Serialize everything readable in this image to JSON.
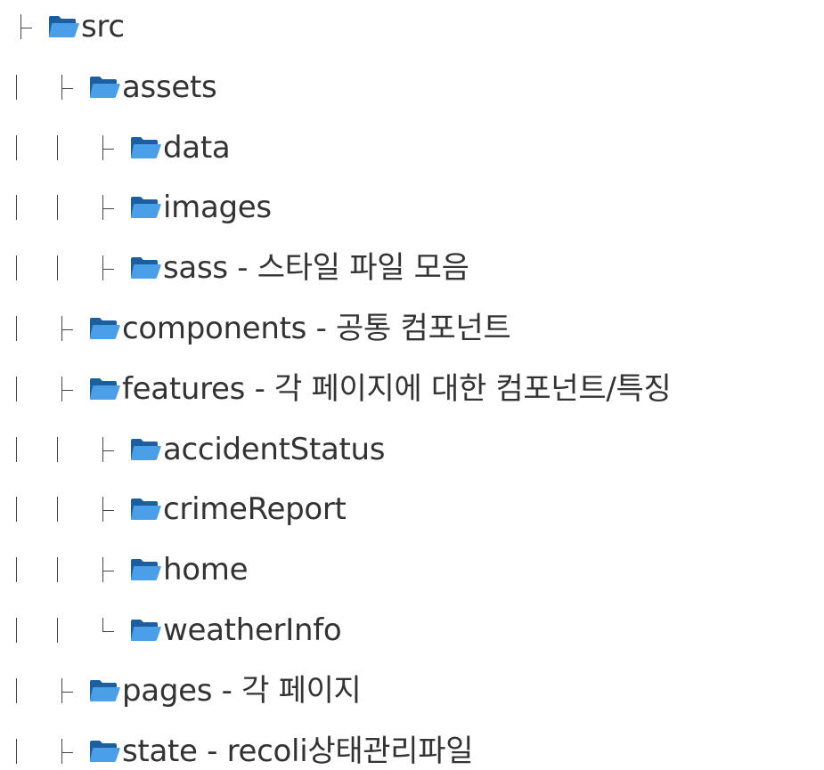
{
  "colors": {
    "folder_front": "#4a9fe8",
    "folder_back": "#1d5f9e",
    "text": "#333333",
    "guide": "#444444"
  },
  "icon": "folder-icon",
  "tree": [
    {
      "depth": 0,
      "branch": "tee",
      "name": "src"
    },
    {
      "depth": 1,
      "branch": "tee",
      "name": "assets"
    },
    {
      "depth": 2,
      "branch": "tee",
      "name": "data"
    },
    {
      "depth": 2,
      "branch": "tee",
      "name": "images"
    },
    {
      "depth": 2,
      "branch": "tee",
      "name": "sass - 스타일 파일 모음"
    },
    {
      "depth": 1,
      "branch": "tee",
      "name": "components - 공통 컴포넌트"
    },
    {
      "depth": 1,
      "branch": "tee",
      "name": "features - 각 페이지에 대한 컴포넌트/특징"
    },
    {
      "depth": 2,
      "branch": "tee",
      "name": "accidentStatus"
    },
    {
      "depth": 2,
      "branch": "tee",
      "name": "crimeReport"
    },
    {
      "depth": 2,
      "branch": "tee",
      "name": "home"
    },
    {
      "depth": 2,
      "branch": "end",
      "name": "weatherInfo"
    },
    {
      "depth": 1,
      "branch": "tee",
      "name": "pages - 각 페이지"
    },
    {
      "depth": 1,
      "branch": "tee",
      "name": "state  - recoli상태관리파일"
    }
  ]
}
